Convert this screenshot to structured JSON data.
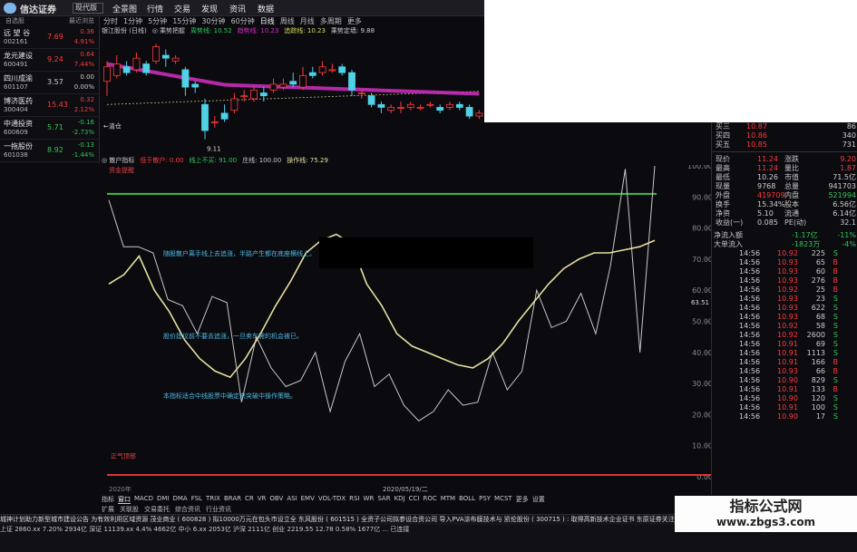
{
  "app": {
    "logo_text": "信达证券",
    "version": "现代版",
    "menus": [
      "全景图",
      "行情",
      "交易",
      "发现",
      "资讯",
      "数据"
    ],
    "periods": [
      "分时",
      "1分钟",
      "5分钟",
      "15分钟",
      "30分钟",
      "60分钟",
      "日线",
      "周线",
      "月线",
      "多周期",
      "更多"
    ]
  },
  "sidebar": {
    "header_left": "自选股",
    "header_right": "最近浏览",
    "stocks": [
      {
        "name": "远 望 谷",
        "code": "002161",
        "price": "7.69",
        "change": "0.36",
        "pct": "4.91%",
        "dir": "up"
      },
      {
        "name": "龙元建设",
        "code": "600491",
        "price": "9.24",
        "change": "0.64",
        "pct": "7.44%",
        "dir": "up"
      },
      {
        "name": "四川成渝",
        "code": "601107",
        "price": "3.57",
        "change": "0.00",
        "pct": "0.00%",
        "dir": "fl"
      },
      {
        "name": "博济医药",
        "code": "300404",
        "price": "15.43",
        "change": "0.32",
        "pct": "2.12%",
        "dir": "up"
      },
      {
        "name": "中通投资",
        "code": "600609",
        "price": "5.71",
        "change": "-0.16",
        "pct": "-2.73%",
        "dir": "dn"
      },
      {
        "name": "一拖股份",
        "code": "601038",
        "price": "8.92",
        "change": "-0.13",
        "pct": "-1.44%",
        "dir": "dn"
      }
    ]
  },
  "kline": {
    "legend": [
      "银江股份 (日线)",
      "◎ 乘势把握",
      "周势线: 10.52",
      "趋势线: 10.23",
      "追踪线: 10.23",
      "乘势定墙: 9.88"
    ],
    "low_label": "9.11",
    "marker_label": "←清仓",
    "candles": [
      [
        1,
        1.7,
        2.2,
        1.2,
        2.4
      ],
      [
        2,
        1.9,
        2.3,
        1.8,
        2.6
      ],
      [
        3,
        2.2,
        2.0,
        1.9,
        2.4
      ],
      [
        4,
        2.1,
        2.5,
        2.0,
        2.7
      ],
      [
        5,
        2.3,
        2.0,
        1.9,
        2.4
      ],
      [
        6,
        2.4,
        2.9,
        2.3,
        3.0
      ],
      [
        7,
        2.6,
        2.5,
        2.2,
        2.8
      ],
      [
        8,
        2.4,
        2.5,
        2.3,
        2.6
      ],
      [
        9,
        2.1,
        1.5,
        1.2,
        2.2
      ],
      [
        10,
        1.6,
        1.5,
        1.3,
        1.7
      ],
      [
        11,
        0.9,
        0.0,
        -0.3,
        1.1
      ],
      [
        12,
        0.3,
        0.3,
        0.1,
        0.5
      ],
      [
        13,
        0.6,
        0.4,
        0.3,
        0.9
      ],
      [
        14,
        0.7,
        1.1,
        0.6,
        1.3
      ],
      [
        15,
        1.2,
        1.2,
        1.0,
        1.4
      ],
      [
        16,
        1.1,
        1.4,
        1.0,
        1.5
      ],
      [
        17,
        1.3,
        1.2,
        1.0,
        1.5
      ],
      [
        18,
        1.4,
        1.6,
        1.3,
        1.8
      ],
      [
        19,
        1.5,
        1.6,
        1.4,
        1.8
      ],
      [
        20,
        1.7,
        1.6,
        1.5,
        2.0
      ],
      [
        21,
        1.5,
        1.9,
        1.4,
        2.2
      ],
      [
        22,
        2.0,
        1.9,
        1.8,
        2.2
      ],
      [
        23,
        2.0,
        2.2,
        1.9,
        2.4
      ],
      [
        24,
        2.1,
        2.1,
        2.0,
        2.3
      ],
      [
        25,
        2.2,
        2.0,
        1.9,
        2.3
      ],
      [
        26,
        2.0,
        1.4,
        1.2,
        2.1
      ],
      [
        27,
        1.3,
        1.3,
        1.1,
        1.4
      ],
      [
        28,
        1.2,
        0.9,
        0.8,
        1.3
      ],
      [
        29,
        0.9,
        0.8,
        0.6,
        1.0
      ],
      [
        30,
        0.7,
        0.8,
        0.6,
        0.9
      ],
      [
        31,
        0.8,
        0.8,
        0.6,
        1.0
      ],
      [
        32,
        0.8,
        0.9,
        0.7,
        1.0
      ],
      [
        33,
        0.8,
        0.8,
        0.7,
        0.9
      ],
      [
        34,
        0.9,
        0.9,
        0.8,
        1.0
      ],
      [
        35,
        0.8,
        0.7,
        0.6,
        0.9
      ],
      [
        36,
        0.8,
        0.9,
        0.7,
        1.0
      ],
      [
        37,
        0.9,
        0.8,
        0.7,
        1.0
      ],
      [
        38,
        0.8,
        0.5,
        0.4,
        0.9
      ],
      [
        39,
        0.5,
        0.6,
        0.4,
        0.7
      ]
    ]
  },
  "indicator": {
    "legend": [
      "◎ 散户指标",
      "低于散户: 0.00",
      "线上不买: 91.00",
      "庄线: 100.00",
      "操作线: 75.29"
    ],
    "label_top": "资金提醒",
    "notes": [
      "随股散户离手线上去追涨，半路产生都在底座横线上。",
      "股价建议前不要去追涨，一旦卖车需的机会被已。",
      "本指标适合中线股票中确定来突破中操作策略。"
    ],
    "bottom_label": "正气顶部",
    "y_ticks": [
      "100.00",
      "90.00",
      "80.00",
      "70.00",
      "60.00",
      "50.00",
      "40.00",
      "30.00",
      "20.00",
      "10.00",
      "0.00"
    ],
    "date_label": "2020/05/19/二",
    "year_label": "2020年",
    "green_level": 91,
    "red_level": 0,
    "white_series": [
      89,
      74,
      74,
      72,
      57,
      55,
      46,
      58,
      56,
      24,
      45,
      35,
      29,
      31,
      40,
      21,
      37,
      46,
      29,
      33,
      23,
      18,
      21,
      28,
      23,
      24,
      40,
      28,
      34,
      60,
      48,
      50,
      59,
      46,
      68,
      99,
      40,
      100
    ],
    "yellow_series": [
      62,
      65,
      71,
      60,
      53,
      44,
      38,
      34,
      32,
      38,
      46,
      55,
      63,
      72,
      76,
      78,
      75,
      62,
      55,
      46,
      42,
      40,
      38,
      36,
      35,
      38,
      43,
      50,
      56,
      62,
      67,
      70,
      72,
      72,
      73,
      74,
      76
    ]
  },
  "bidask": [
    {
      "label": "买三",
      "price": "10.87",
      "vol": "86"
    },
    {
      "label": "买四",
      "price": "10.86",
      "vol": "340"
    },
    {
      "label": "买五",
      "price": "10.85",
      "vol": "731"
    }
  ],
  "quote": [
    {
      "l1": "现价",
      "v1": "11.24",
      "l2": "涨跌",
      "v2": "9.20"
    },
    {
      "l1": "最高",
      "v1": "11.24",
      "l2": "量比",
      "v2": "1.87"
    },
    {
      "l1": "最低",
      "v1": "10.26",
      "l2": "市值",
      "v2": "71.5亿"
    },
    {
      "l1": "现量",
      "v1": "9768",
      "l2": "总量",
      "v2": "941703"
    },
    {
      "l1": "外盘",
      "v1": "419709",
      "l2": "内盘",
      "v2": "521994"
    },
    {
      "l1": "换手",
      "v1": "15.34%",
      "l2": "股本",
      "v2": "6.56亿"
    },
    {
      "l1": "净资",
      "v1": "5.10",
      "l2": "流通",
      "v2": "6.14亿"
    },
    {
      "l1": "收益(一)",
      "v1": "0.085",
      "l2": "PE(动)",
      "v2": "32.1"
    }
  ],
  "flows": [
    {
      "label": "净流入额",
      "value": "-1.17亿",
      "pct": "-11%"
    },
    {
      "label": "大单流入",
      "value": "-1823万",
      "pct": "-4%"
    }
  ],
  "ticks": [
    [
      "14:56",
      "10.92",
      "225",
      "S"
    ],
    [
      "14:56",
      "10.93",
      "65",
      "B"
    ],
    [
      "14:56",
      "10.93",
      "60",
      "B"
    ],
    [
      "14:56",
      "10.93",
      "276",
      "B"
    ],
    [
      "14:56",
      "10.92",
      "25",
      "B"
    ],
    [
      "14:56",
      "10.93",
      "23",
      "S"
    ],
    [
      "14:56",
      "10.93",
      "622",
      "S"
    ],
    [
      "14:56",
      "10.93",
      "68",
      "S"
    ],
    [
      "14:56",
      "10.92",
      "58",
      "S"
    ],
    [
      "14:56",
      "10.92",
      "2600",
      "S"
    ],
    [
      "14:56",
      "10.91",
      "69",
      "S"
    ],
    [
      "14:56",
      "10.91",
      "1113",
      "S"
    ],
    [
      "14:56",
      "10.91",
      "166",
      "B"
    ],
    [
      "14:56",
      "10.93",
      "66",
      "B"
    ],
    [
      "14:56",
      "10.90",
      "829",
      "S"
    ],
    [
      "14:56",
      "10.91",
      "133",
      "B"
    ],
    [
      "14:56",
      "10.90",
      "120",
      "S"
    ],
    [
      "14:56",
      "10.91",
      "100",
      "S"
    ],
    [
      "14:56",
      "10.90",
      "17",
      "S"
    ]
  ],
  "side_value": "63.51",
  "bottom_tabs": [
    "指标",
    "窗口",
    "MACD",
    "DMI",
    "DMA",
    "FSL",
    "TRIX",
    "BRAR",
    "CR",
    "VR",
    "OBV",
    "ASI",
    "EMV",
    "VOL-TDX",
    "RSI",
    "WR",
    "SAR",
    "KDJ",
    "CCI",
    "ROC",
    "MTM",
    "BOLL",
    "PSY",
    "MCST",
    "更多",
    "设置"
  ],
  "sub_tabs": [
    "扩展",
    "关联股",
    "交易委托",
    "综合资讯",
    "行业资讯"
  ],
  "news": "城神计划助力新型城市建设公告    为有效利用区域资源 茂业商业 ( 600828 ) 拟10000万元在包头市设立全    东风股份 ( 601515 ) 全资子公司拟参设合资公司 导入PVA涂布膜技术与    凯伦股份 ( 300715 ) : 取得高新技术企业证书  东原证券关注",
  "status": "上证 2860.xx  7.20%  2934亿  深证 11139.xx  4.4%  4662亿  中小  6.xx  2053亿  沪深 2111亿  创业 2219.55  12.78  0.58%  1677亿  ... 已连接",
  "watermark": {
    "line1": "指标公式网",
    "line2": "www.zbgs3.com"
  },
  "colors": {
    "up": "#ff3b3b",
    "down": "#34c759",
    "green_line": "#3fbf3f",
    "red_line": "#d93636",
    "yellow": "#e8e0a0",
    "white": "#c9c9c9",
    "magenta": "#d32fc2"
  }
}
